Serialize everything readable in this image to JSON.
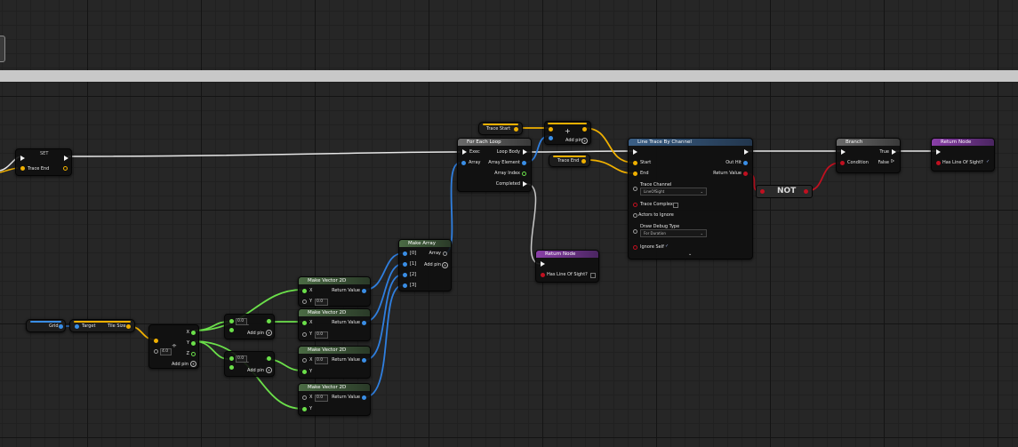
{
  "colors": {
    "exec": "#f2f2f2",
    "vector": "#f0b000",
    "float": "#6be04a",
    "object": "#3a8ee6",
    "bool": "#c01020"
  },
  "set_node": {
    "title": "SET",
    "pin_label": "Trace End"
  },
  "trace_start": {
    "label": "Trace Start"
  },
  "trace_end_var": {
    "label": "Trace End"
  },
  "add_node": {
    "symbol": "+",
    "add_pin": "Add pin"
  },
  "for_each": {
    "title": "For Each Loop",
    "exec": "Exec",
    "array": "Array",
    "loop_body": "Loop Body",
    "array_element": "Array Element",
    "array_index": "Array Index",
    "completed": "Completed"
  },
  "line_trace": {
    "title": "Line Trace By Channel",
    "start": "Start",
    "end": "End",
    "out_hit": "Out Hit",
    "return_value": "Return Value",
    "trace_channel": "Trace Channel",
    "trace_channel_value": "LineOfSight",
    "trace_complex": "Trace Complex",
    "actors_to_ignore": "Actors to Ignore",
    "draw_debug_type": "Draw Debug Type",
    "draw_debug_value": "For Duration",
    "ignore_self": "Ignore Self"
  },
  "not_node": {
    "label": "NOT"
  },
  "branch": {
    "title": "Branch",
    "condition": "Condition",
    "true": "True",
    "false": "False"
  },
  "return_node_1": {
    "title": "Return Node",
    "pin": "Has Line Of Sight?"
  },
  "return_node_2": {
    "title": "Return Node",
    "pin": "Has Line Of Sight?"
  },
  "make_array": {
    "title": "Make Array",
    "items": [
      "[0]",
      "[1]",
      "[2]",
      "[3]"
    ],
    "array": "Array",
    "add_pin": "Add pin"
  },
  "vectors": [
    {
      "title": "Make Vector 2D",
      "x": "X",
      "y": "Y",
      "y_value": "0.0",
      "return": "Return Value"
    },
    {
      "title": "Make Vector 2D",
      "x": "X",
      "y": "Y",
      "y_value": "0.0",
      "return": "Return Value"
    },
    {
      "title": "Make Vector 2D",
      "x": "X",
      "x_value": "0.0",
      "y": "Y",
      "return": "Return Value"
    },
    {
      "title": "Make Vector 2D",
      "x": "X",
      "x_value": "0.0",
      "y": "Y",
      "return": "Return Value"
    }
  ],
  "grid_var": {
    "label": "Grid"
  },
  "tile_size": {
    "target": "Target",
    "label": "Tile Size"
  },
  "divide_node": {
    "symbol": "÷",
    "value": "4.0",
    "x": "X",
    "y": "Y",
    "z": "Z",
    "add_pin": "Add pin"
  },
  "sub_nodes": [
    {
      "value": "0.0",
      "symbol": "-",
      "add_pin": "Add pin"
    },
    {
      "value": "0.0",
      "symbol": "-",
      "add_pin": "Add pin"
    }
  ]
}
